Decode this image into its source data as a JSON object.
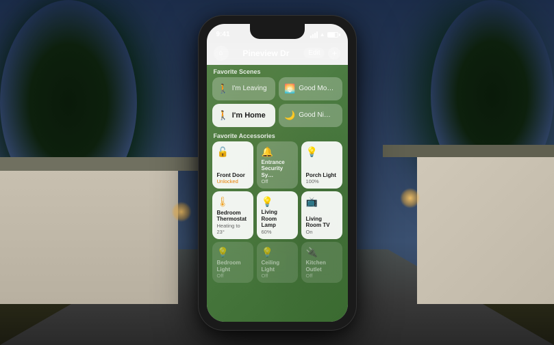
{
  "bg": {
    "desc": "House exterior at night"
  },
  "phone": {
    "status_bar": {
      "time": "9:41",
      "signal": true,
      "wifi": true,
      "battery": true
    },
    "header": {
      "home_icon": "⌂",
      "title": "Pineview Dr",
      "edit_label": "Edit",
      "add_icon": "+"
    },
    "scenes_section_label": "Favorite Scenes",
    "scenes": [
      {
        "label": "I'm Leaving",
        "icon": "🚶",
        "active": false
      },
      {
        "label": "Good Mo…",
        "icon": "🌅",
        "active": false
      },
      {
        "label": "I'm Home",
        "icon": "🚶",
        "active": true,
        "full_width": true
      },
      {
        "label": "Good Ni…",
        "icon": "🌙",
        "active": false
      }
    ],
    "accessories_section_label": "Favorite Accessories",
    "accessories": [
      {
        "name": "Front Door",
        "status": "Unlocked",
        "icon": "🔓",
        "active": true
      },
      {
        "name": "Entrance Security Sy…",
        "status": "Off",
        "icon": "🔔",
        "active": false
      },
      {
        "name": "Porch Light",
        "status": "100%",
        "icon": "💡",
        "active": true
      },
      {
        "name": "Bedroom Thermostat",
        "status": "Heating to 23°",
        "icon": "🌡",
        "active": true
      },
      {
        "name": "Living Room Lamp",
        "status": "60%",
        "icon": "💡",
        "active": true
      },
      {
        "name": "Living Room TV",
        "status": "On",
        "icon": "📺",
        "active": true
      },
      {
        "name": "Bedroom Light",
        "status": "Off",
        "icon": "💡",
        "active": false,
        "faded": true
      },
      {
        "name": "Ceiling Light",
        "status": "Off",
        "icon": "💡",
        "active": false,
        "faded": true
      },
      {
        "name": "Kitchen Outlet",
        "status": "Off",
        "icon": "🔌",
        "active": false,
        "faded": true
      }
    ]
  }
}
